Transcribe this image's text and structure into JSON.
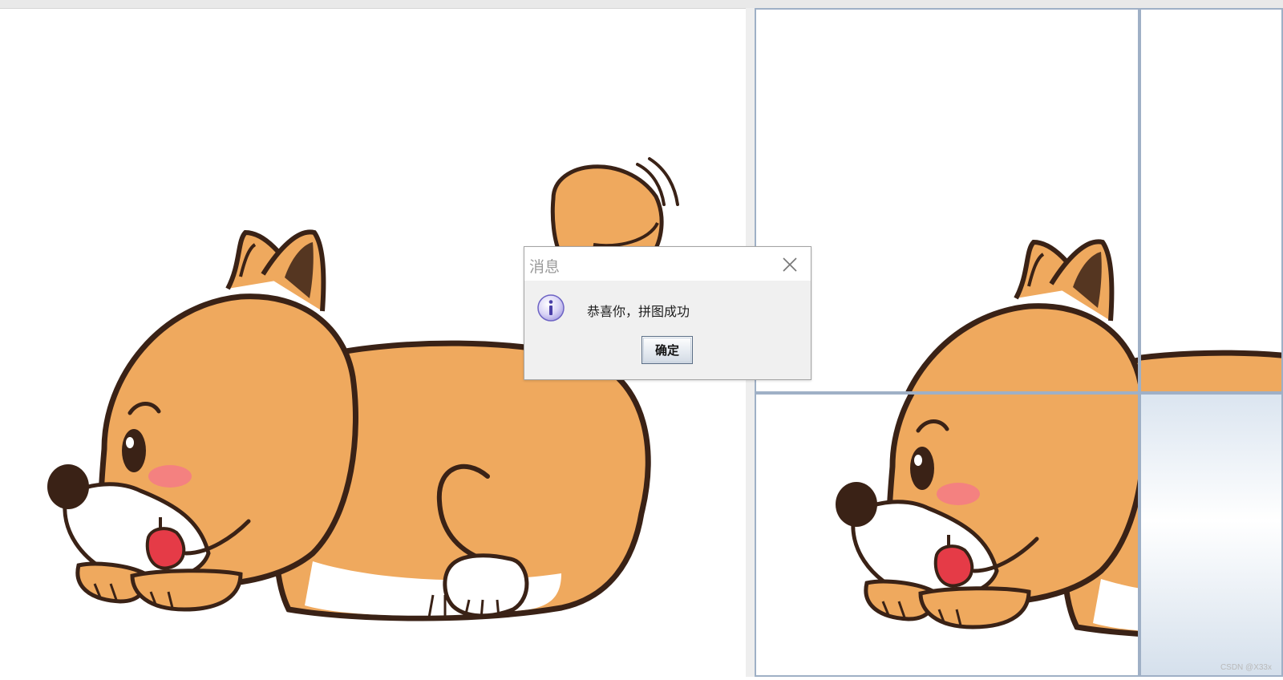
{
  "dialog": {
    "title": "消息",
    "message": "恭喜你，拼图成功",
    "ok_label": "确定",
    "icon": "info-icon",
    "close_icon": "close-icon"
  },
  "puzzle": {
    "icons": [
      "shiba-dog-illustration"
    ],
    "blank_tile": "bottom-right"
  },
  "watermark": "CSDN @X33x",
  "colors": {
    "dog_fur": "#EFA95E",
    "dog_outline": "#3A2216",
    "cheek": "#F47C84",
    "tile_border": "#9FB0C6",
    "dialog_bg": "#F0F0F0"
  }
}
